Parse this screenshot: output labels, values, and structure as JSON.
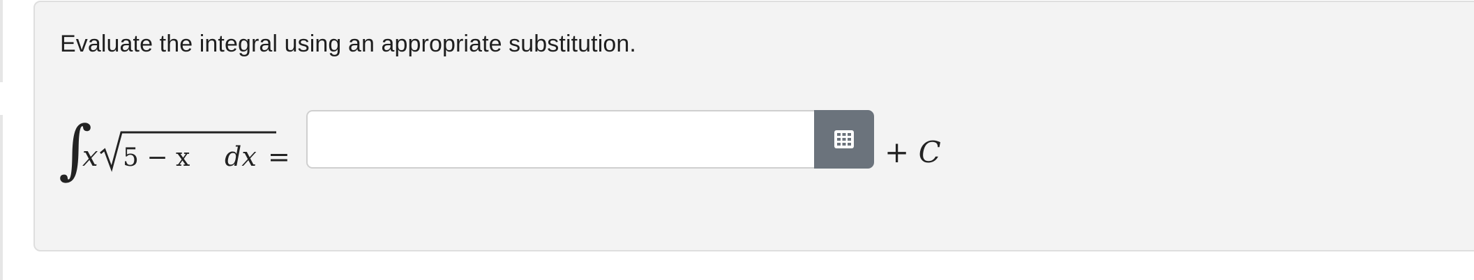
{
  "question": {
    "prompt": "Evaluate the integral using an appropriate substitution."
  },
  "equation": {
    "integral_sign": "∫",
    "var_x": "x",
    "radical_contents": "5 − x",
    "differential": "dx",
    "equals": "="
  },
  "answer": {
    "value": "",
    "placeholder": ""
  },
  "keypad": {
    "icon": "keypad-icon"
  },
  "constant": {
    "plus": "+",
    "symbol": "C"
  },
  "colors": {
    "card_bg": "#f3f3f3",
    "keypad_bg": "#6b737c",
    "text": "#1f1f1f"
  }
}
